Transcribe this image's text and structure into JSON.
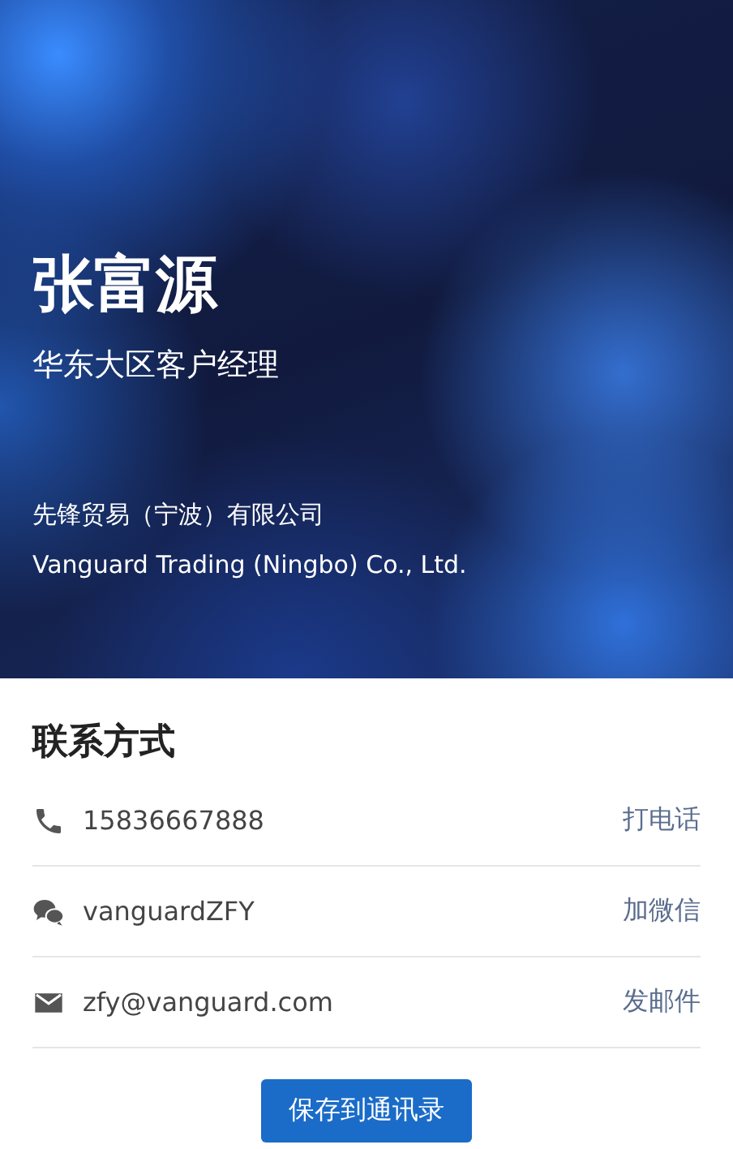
{
  "header": {
    "name": "张富源",
    "title": "华东大区客户经理",
    "company_cn": "先锋贸易（宁波）有限公司",
    "company_en": "Vanguard Trading (Ningbo) Co., Ltd."
  },
  "contact": {
    "heading": "联系方式",
    "items": [
      {
        "kind": "phone",
        "value": "15836667888",
        "action": "打电话"
      },
      {
        "kind": "wechat",
        "value": "vanguardZFY",
        "action": "加微信"
      },
      {
        "kind": "email",
        "value": "zfy@vanguard.com",
        "action": "发邮件"
      }
    ]
  },
  "save_button": "保存到通讯录"
}
